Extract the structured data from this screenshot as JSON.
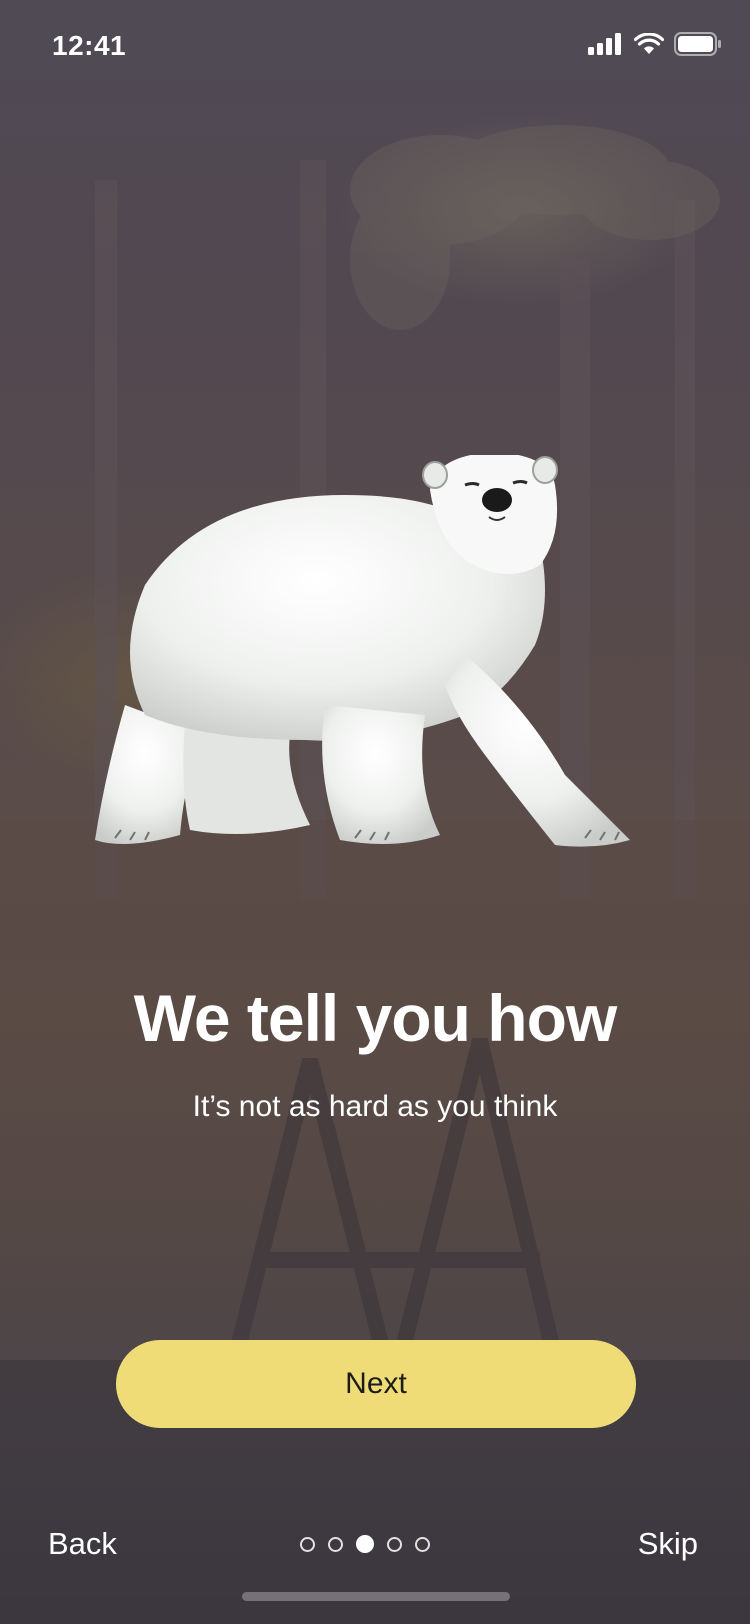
{
  "status_bar": {
    "time": "12:41"
  },
  "hero": {
    "image": "polar-bear"
  },
  "headline": "We tell you how",
  "subtitle": "It’s not as hard as you think",
  "actions": {
    "next_label": "Next",
    "back_label": "Back",
    "skip_label": "Skip"
  },
  "pager": {
    "total": 5,
    "current": 3
  },
  "colors": {
    "accent": "#efdc76",
    "background": "#4a4248"
  }
}
